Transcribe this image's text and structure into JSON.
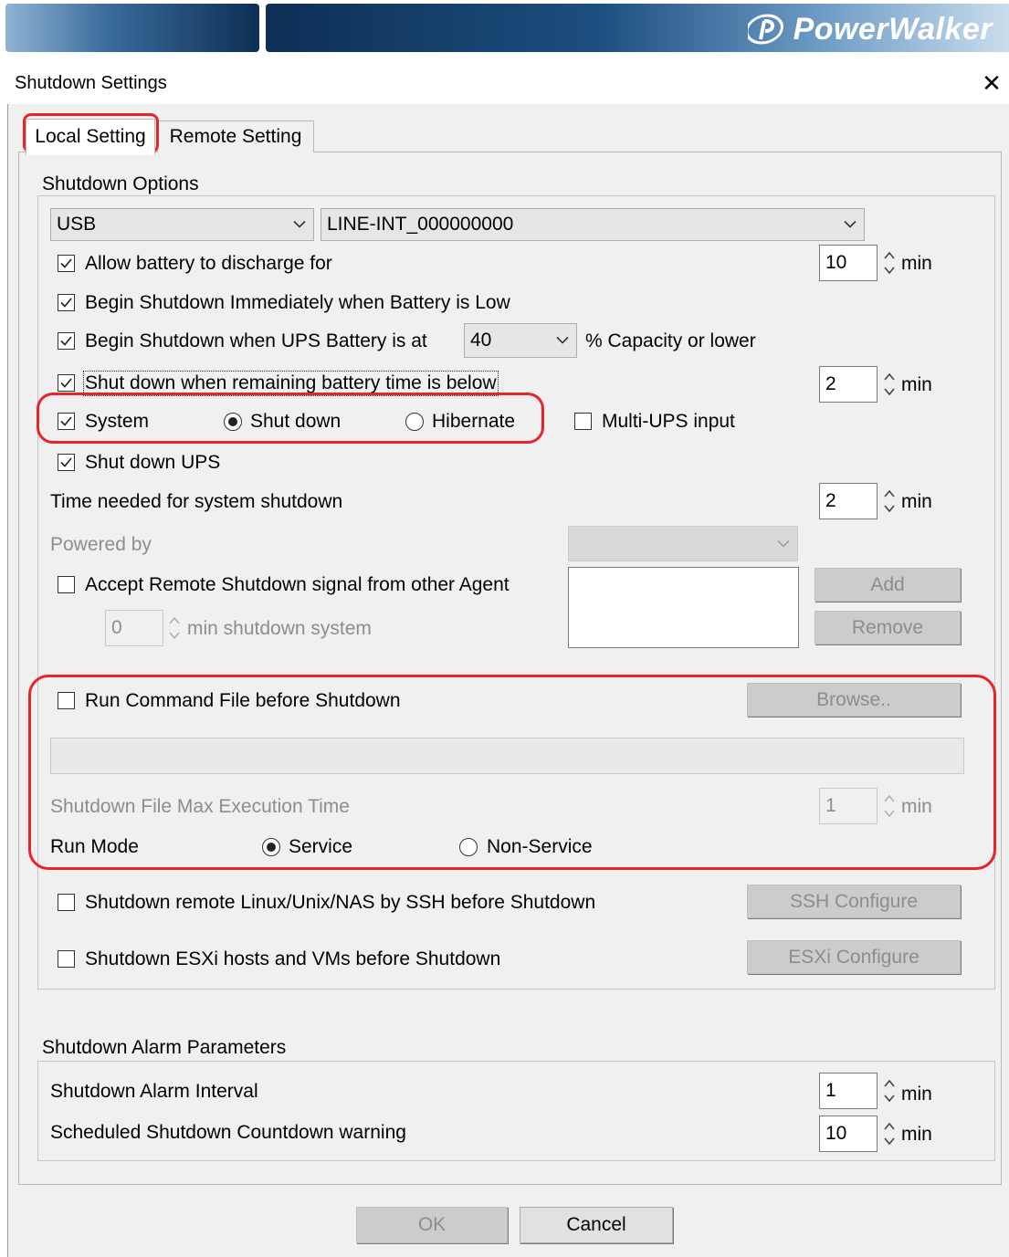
{
  "banner": {
    "brand": "PowerWalker",
    "colors": {
      "dark": "#0d2f55",
      "light": "#8fb3d4"
    }
  },
  "dialog": {
    "title": "Shutdown Settings",
    "close_glyph": "✕"
  },
  "tabs": [
    {
      "label": "Local Setting",
      "selected": true
    },
    {
      "label": "Remote Setting",
      "selected": false
    }
  ],
  "shutdown_options": {
    "group_title": "Shutdown Options",
    "port_select": "USB",
    "ups_select": "LINE-INT_000000000",
    "allow_discharge": {
      "label": "Allow battery to discharge for",
      "checked": true,
      "value": "10",
      "unit": "min"
    },
    "begin_low": {
      "label": "Begin Shutdown Immediately when Battery is Low",
      "checked": true
    },
    "begin_capacity": {
      "label": "Begin Shutdown when UPS Battery is at",
      "checked": true,
      "value": "40",
      "suffix": "% Capacity or lower"
    },
    "remaining_time": {
      "label": "Shut down when remaining battery time is below",
      "checked": true,
      "value": "2",
      "unit": "min"
    },
    "system": {
      "label": "System",
      "checked": true
    },
    "mode_shutdown": {
      "label": "Shut down",
      "selected": true
    },
    "mode_hibernate": {
      "label": "Hibernate",
      "selected": false
    },
    "multi_ups": {
      "label": "Multi-UPS input",
      "checked": false
    },
    "shutdown_ups": {
      "label": "Shut down UPS",
      "checked": true
    },
    "time_needed": {
      "label": "Time needed for system shutdown",
      "value": "2",
      "unit": "min"
    },
    "powered_by": {
      "label": "Powered by",
      "value": ""
    },
    "accept_remote": {
      "label": "Accept Remote Shutdown signal from other Agent",
      "checked": false,
      "value": "0",
      "suffix": "min shutdown system"
    },
    "add_label": "Add",
    "remove_label": "Remove",
    "run_command": {
      "label": "Run Command File before Shutdown",
      "checked": false,
      "browse_label": "Browse..",
      "path": ""
    },
    "max_exec": {
      "label": "Shutdown File Max Execution Time",
      "value": "1",
      "unit": "min"
    },
    "run_mode": {
      "label": "Run Mode",
      "service": "Service",
      "non_service": "Non-Service",
      "selected": "Service"
    },
    "ssh": {
      "label": "Shutdown remote Linux/Unix/NAS by SSH before Shutdown",
      "checked": false,
      "button": "SSH Configure"
    },
    "esxi": {
      "label": "Shutdown ESXi hosts and VMs before Shutdown",
      "checked": false,
      "button": "ESXi Configure"
    }
  },
  "alarm": {
    "group_title": "Shutdown Alarm Parameters",
    "interval": {
      "label": "Shutdown Alarm Interval",
      "value": "1",
      "unit": "min"
    },
    "countdown": {
      "label": "Scheduled Shutdown Countdown warning",
      "value": "10",
      "unit": "min"
    }
  },
  "footer": {
    "ok_label": "OK",
    "cancel_label": "Cancel"
  },
  "highlight_color": "#e8232a"
}
